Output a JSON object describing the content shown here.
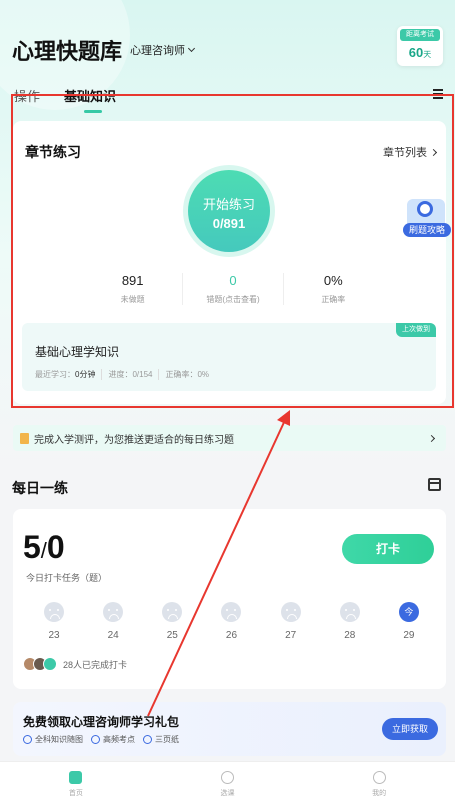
{
  "header": {
    "app_title": "心理快题库",
    "subject": "心理咨询师"
  },
  "exam_countdown": {
    "label": "距离考试",
    "days": "60",
    "unit": "天"
  },
  "tabs": [
    {
      "label": "操作"
    },
    {
      "label": "基础知识"
    }
  ],
  "chapter": {
    "title": "章节练习",
    "list_link": "章节列表",
    "start_label": "开始练习",
    "start_count": "0/891",
    "stats": [
      {
        "value": "891",
        "label": "未做题"
      },
      {
        "value": "0",
        "label": "错题(点击查看)"
      },
      {
        "value": "0%",
        "label": "正确率"
      }
    ],
    "last_badge": "上次做到",
    "last_name": "基础心理学知识",
    "last_study_label": "最近学习：",
    "last_study_value": "0分钟",
    "progress": "进度：0/154",
    "accuracy": "正确率：0%"
  },
  "floating_badge": {
    "label": "刷题攻略"
  },
  "banner": {
    "text": "完成入学测评，为您推送更适合的每日练习题"
  },
  "daily": {
    "title": "每日一练",
    "score_main": "5",
    "score_sep": "/",
    "score_second": "0",
    "task_label": "今日打卡任务（题）",
    "checkin_label": "打卡",
    "days": [
      {
        "num": "23"
      },
      {
        "num": "24"
      },
      {
        "num": "25"
      },
      {
        "num": "26"
      },
      {
        "num": "27"
      },
      {
        "num": "28"
      },
      {
        "num": "29",
        "today_label": "今"
      }
    ],
    "completed_text": "28人已完成打卡"
  },
  "gift": {
    "title": "免费领取心理咨询师学习礼包",
    "tags": [
      "全科知识随图",
      "高频考点",
      "三页纸"
    ],
    "button": "立即获取"
  },
  "bottom_nav": [
    {
      "label": "首页"
    },
    {
      "label": "选课"
    },
    {
      "label": "我的"
    }
  ],
  "colors": {
    "accent": "#3cc9a8",
    "blue": "#3b6ae0",
    "annotation_red": "#e8372f"
  }
}
